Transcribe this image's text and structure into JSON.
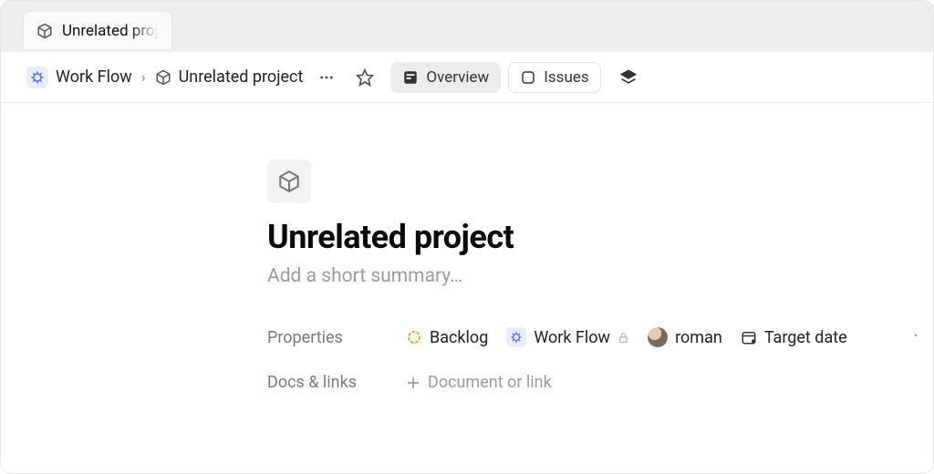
{
  "tabstrip": {
    "tab_label": "Unrelated proj"
  },
  "breadcrumb": {
    "workspace": "Work Flow",
    "project": "Unrelated project"
  },
  "toolbar": {
    "overview": "Overview",
    "issues": "Issues"
  },
  "project": {
    "title": "Unrelated project",
    "summary_placeholder": "Add a short summary…"
  },
  "properties": {
    "label": "Properties",
    "status": "Backlog",
    "team": "Work Flow",
    "lead": "roman",
    "target_date": "Target date"
  },
  "docs": {
    "label": "Docs & links",
    "placeholder": "Document or link"
  }
}
